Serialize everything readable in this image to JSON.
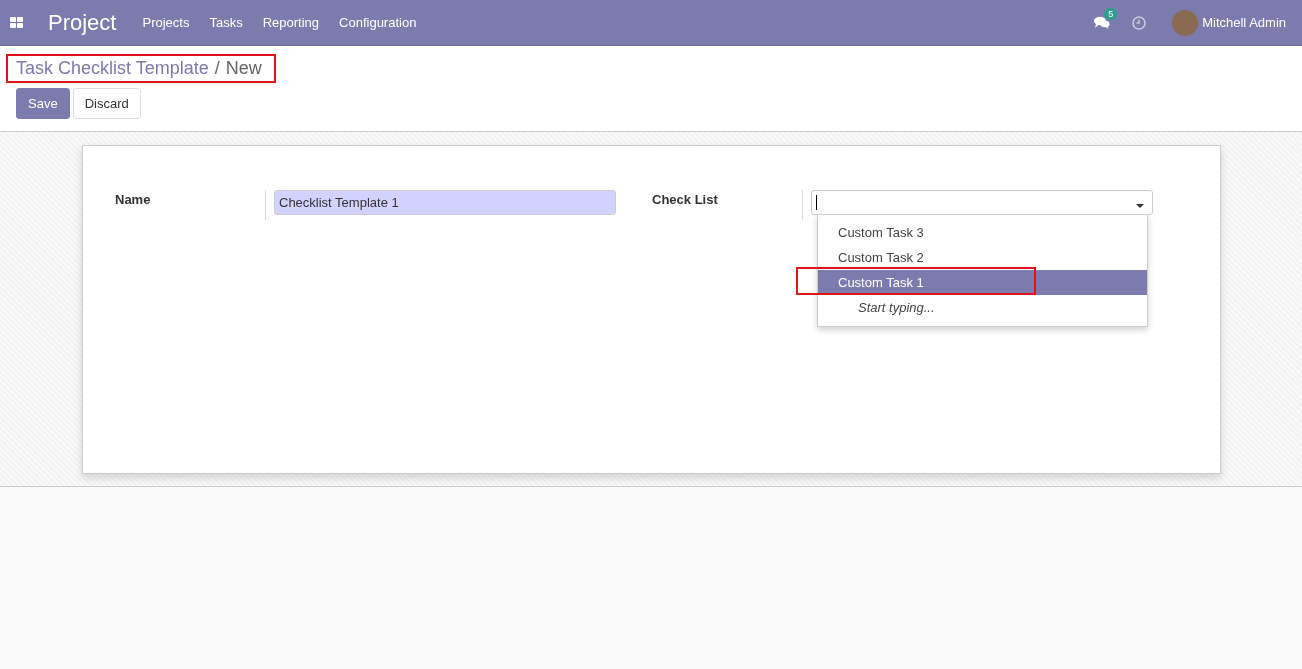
{
  "navbar": {
    "app_name": "Project",
    "menu": [
      "Projects",
      "Tasks",
      "Reporting",
      "Configuration"
    ],
    "messages_count": "5",
    "user_name": "Mitchell Admin"
  },
  "breadcrumb": {
    "parent": "Task Checklist Template",
    "separator": "/",
    "current": "New",
    "annotated": true
  },
  "buttons": [
    {
      "label": "Save",
      "kind": "primary"
    },
    {
      "label": "Discard",
      "kind": "secondary"
    }
  ],
  "form": {
    "name_label": "Name",
    "name_value": "Checklist Template 1",
    "checklist_label": "Check List"
  },
  "dropdown": {
    "options": [
      {
        "label": "Custom Task 3",
        "selected": false,
        "annotated": false
      },
      {
        "label": "Custom Task 2",
        "selected": false,
        "annotated": false
      },
      {
        "label": "Custom Task 1",
        "selected": true,
        "annotated": true
      }
    ],
    "hint": "Start typing..."
  }
}
